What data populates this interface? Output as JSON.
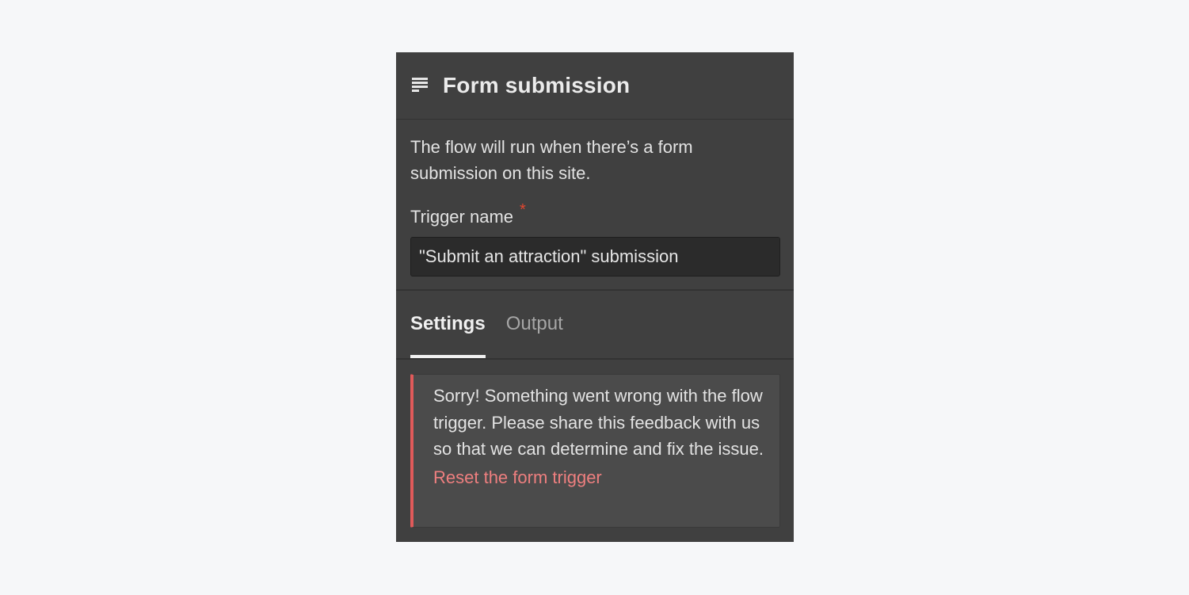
{
  "panel": {
    "title": "Form submission",
    "icon": "form-icon",
    "description": "The flow will run when there’s a form submission on this site.",
    "field": {
      "label": "Trigger name",
      "required_marker": "*",
      "value": "\"Submit an attraction\" submission"
    },
    "tabs": [
      {
        "label": "Settings",
        "active": true
      },
      {
        "label": "Output",
        "active": false
      }
    ],
    "error": {
      "message": "Sorry! Something went wrong with the flow trigger. Please share this feedback with us so that we can determine and fix the issue.",
      "link": "Reset the form trigger"
    }
  },
  "colors": {
    "page_background": "#f6f7f9",
    "panel_background": "#404040",
    "required": "#e2462f",
    "error_border": "#e05a5a",
    "error_link": "#ee7f7f"
  }
}
